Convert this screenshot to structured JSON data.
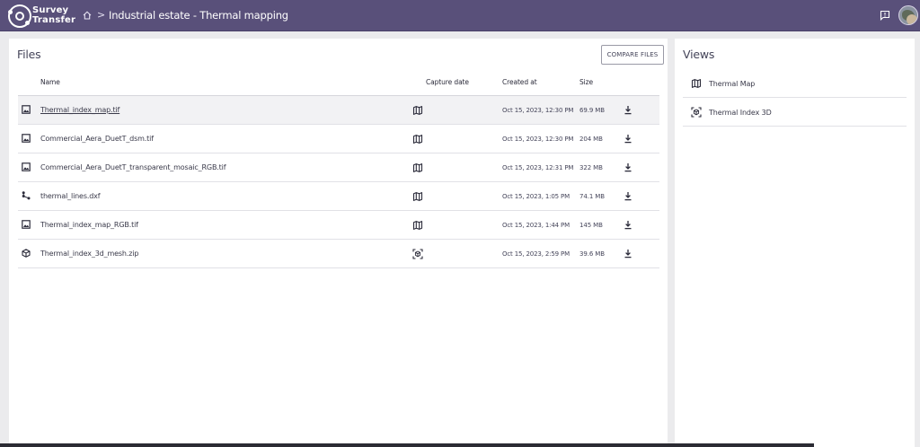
{
  "app": {
    "logo_line1": "Survey",
    "logo_line2": "Transfer",
    "breadcrumb_separator": ">",
    "breadcrumb_title": "Industrial estate - Thermal mapping",
    "colors": {
      "topbar": "#59507a",
      "panel": "#ffffff",
      "background": "#ebebed"
    }
  },
  "files": {
    "title": "Files",
    "compare_label": "COMPARE FILES",
    "columns": {
      "name": "Name",
      "capture_date": "Capture date",
      "created_at": "Created at",
      "size": "Size"
    },
    "rows": [
      {
        "file_icon": "image-icon",
        "name": "Thermal_index_map.tif",
        "view_icon": "map-icon",
        "capture_date": "",
        "created_at": "Oct 15, 2023, 12:30 PM",
        "size": "69.9 MB",
        "selected": true
      },
      {
        "file_icon": "image-icon",
        "name": "Commercial_Aera_DuetT_dsm.tif",
        "view_icon": "map-icon",
        "capture_date": "",
        "created_at": "Oct 15, 2023, 12:30 PM",
        "size": "204 MB"
      },
      {
        "file_icon": "image-icon",
        "name": "Commercial_Aera_DuetT_transparent_mosaic_RGB.tif",
        "view_icon": "map-icon",
        "capture_date": "",
        "created_at": "Oct 15, 2023, 12:31 PM",
        "size": "322 MB"
      },
      {
        "file_icon": "share-vector-icon",
        "name": "thermal_lines.dxf",
        "view_icon": "map-icon",
        "capture_date": "",
        "created_at": "Oct 15, 2023, 1:05 PM",
        "size": "74.1 MB"
      },
      {
        "file_icon": "image-icon",
        "name": "Thermal_index_map_RGB.tif",
        "view_icon": "map-icon",
        "capture_date": "",
        "created_at": "Oct 15, 2023, 1:44 PM",
        "size": "145 MB"
      },
      {
        "file_icon": "cube-icon",
        "name": "Thermal_index_3d_mesh.zip",
        "view_icon": "3d-view-icon",
        "capture_date": "",
        "created_at": "Oct 15, 2023, 2:59 PM",
        "size": "39.6 MB"
      }
    ]
  },
  "views": {
    "title": "Views",
    "items": [
      {
        "icon": "map-icon",
        "label": "Thermal Map"
      },
      {
        "icon": "3d-view-icon",
        "label": "Thermal Index 3D"
      }
    ]
  }
}
